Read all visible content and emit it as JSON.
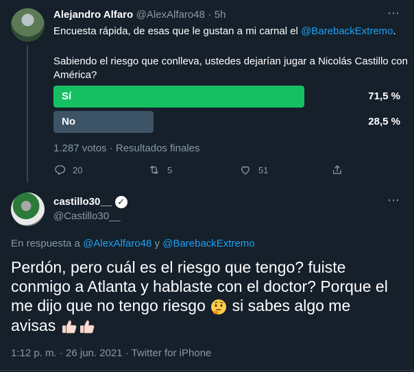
{
  "tweet1": {
    "name": "Alejandro Alfaro",
    "handle": "@AlexAlfaro48",
    "separator": "·",
    "time": "5h",
    "text_prefix": "Encuesta rápida, de esas que le gustan a mi carnal el ",
    "mention": "@BarebackExtremo",
    "text_suffix": ".",
    "question": "Sabiendo el riesgo que conlleva, ustedes dejarían jugar a Nicolás Castillo con América?",
    "poll": {
      "options": [
        {
          "label": "Sí",
          "percent_text": "71,5 %",
          "percent": 71.5,
          "color": "#17bf63"
        },
        {
          "label": "No",
          "percent_text": "28,5 %",
          "percent": 28.5,
          "color": "#3d5466"
        }
      ],
      "summary": "1.287 votos · Resultados finales"
    },
    "actions": {
      "replies": "20",
      "retweets": "5",
      "likes": "51"
    }
  },
  "tweet2": {
    "name": "castillo30__",
    "handle": "@Castillo30__",
    "reply_prefix": "En respuesta a ",
    "reply_mention1": "@AlexAlfaro48",
    "reply_and": " y ",
    "reply_mention2": "@BarebackExtremo",
    "body": "Perdón, pero cuál es el riesgo que tengo? fuiste conmigo a Atlanta y hablaste con el doctor? Porque el me dijo que no tengo riesgo",
    "body_tail1": " si sabes algo me",
    "body_tail2": "avisas",
    "meta": "1:12 p. m. · 26 jun. 2021 · Twitter for iPhone"
  },
  "colors": {
    "background": "#15202b",
    "link": "#1da1f2",
    "muted": "#8899a6",
    "divider": "#38444d"
  }
}
